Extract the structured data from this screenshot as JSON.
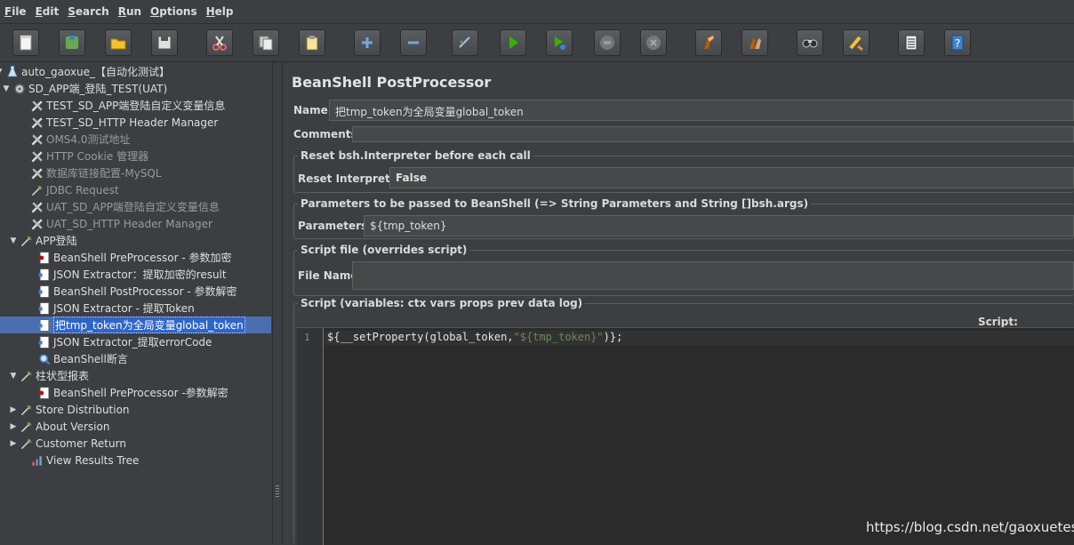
{
  "menu": [
    {
      "u": "F",
      "rest": "ile"
    },
    {
      "u": "E",
      "rest": "dit"
    },
    {
      "u": "S",
      "rest": "earch"
    },
    {
      "u": "R",
      "rest": "un"
    },
    {
      "u": "O",
      "rest": "ptions"
    },
    {
      "u": "H",
      "rest": "elp"
    }
  ],
  "toolbar": [
    "new-icon",
    "templates-icon",
    "open-icon",
    "save-icon",
    "cut-icon",
    "copy-icon",
    "paste-icon",
    "expand-icon",
    "collapse-icon",
    "toggle-icon",
    "start-icon",
    "start-no-pause-icon",
    "stop-icon",
    "shutdown-icon",
    "clear-icon",
    "clear-all-icon",
    "search-icon",
    "reset-search-icon",
    "function-helper-icon",
    "help-icon"
  ],
  "tree": [
    {
      "label": "auto_gaoxue_【自动化测试】",
      "twisty": "▼",
      "icon": "test-plan-icon"
    },
    {
      "label": "SD_APP端_登陆_TEST(UAT)",
      "twisty": "▼",
      "icon": "thread-group-icon"
    },
    {
      "label": "TEST_SD_APP端登陆自定义变量信息",
      "icon": "config-element-icon"
    },
    {
      "label": "TEST_SD_HTTP Header Manager",
      "icon": "config-element-icon"
    },
    {
      "label": "OMS4.0测试地址",
      "icon": "config-element-icon",
      "disabled": true
    },
    {
      "label": "HTTP Cookie 管理器",
      "icon": "config-element-icon",
      "disabled": true
    },
    {
      "label": "数据库链接配置-MySQL",
      "icon": "config-element-icon",
      "disabled": true
    },
    {
      "label": "JDBC Request",
      "icon": "sampler-icon",
      "disabled": true
    },
    {
      "label": "UAT_SD_APP端登陆自定义变量信息",
      "icon": "config-element-icon",
      "disabled": true
    },
    {
      "label": "UAT_SD_HTTP Header Manager",
      "icon": "config-element-icon",
      "disabled": true
    },
    {
      "label": "APP登陆",
      "twisty": "▼",
      "icon": "sampler-icon"
    },
    {
      "label": "BeanShell PreProcessor - 参数加密",
      "icon": "preprocessor-icon"
    },
    {
      "label": "JSON Extractor：提取加密的result",
      "icon": "postprocessor-icon"
    },
    {
      "label": "BeanShell PostProcessor - 参数解密",
      "icon": "postprocessor-icon"
    },
    {
      "label": "JSON Extractor - 提取Token",
      "icon": "postprocessor-icon"
    },
    {
      "label": "把tmp_token为全局变量global_token",
      "icon": "postprocessor-icon",
      "selected": true
    },
    {
      "label": "JSON Extractor_提取errorCode",
      "icon": "postprocessor-icon"
    },
    {
      "label": "BeanShell断言",
      "icon": "assertion-icon"
    },
    {
      "label": "柱状型报表",
      "twisty": "▼",
      "icon": "sampler-icon"
    },
    {
      "label": "BeanShell PreProcessor -参数解密",
      "icon": "preprocessor-icon"
    },
    {
      "label": "Store Distribution",
      "twisty": "▶",
      "icon": "sampler-icon"
    },
    {
      "label": "About Version",
      "twisty": "▶",
      "icon": "sampler-icon"
    },
    {
      "label": "Customer Return",
      "twisty": "▶",
      "icon": "sampler-icon"
    },
    {
      "label": "View Results Tree",
      "icon": "listener-icon"
    }
  ],
  "panel": {
    "title": "BeanShell PostProcessor",
    "name_label": "Name:",
    "name_value": "把tmp_token为全局变量global_token",
    "comments_label": "Comments:",
    "reset_group": "Reset bsh.Interpreter before each call",
    "reset_label": "Reset Interpreter:",
    "reset_value": "False",
    "params_group": "Parameters to be passed to BeanShell (=> String Parameters and String []bsh.args)",
    "params_label": "Parameters:",
    "params_value": "${tmp_token}",
    "file_group": "Script file (overrides script)",
    "file_label": "File Name:",
    "script_group": "Script (variables: ctx vars props prev data log)",
    "script_label": "Script:",
    "line_number": "1",
    "code_prefix": "${__setProperty(global_token,",
    "code_string": "\"${tmp_token}\"",
    "code_suffix": ")};"
  },
  "watermark": "https://blog.csdn.net/gaoxuetest"
}
